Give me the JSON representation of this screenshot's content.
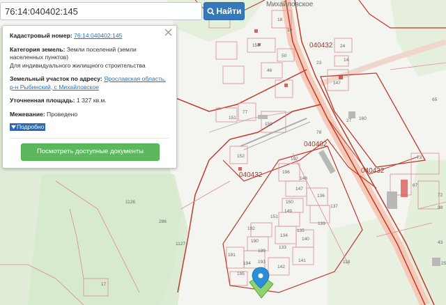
{
  "search": {
    "value": "76:14:040402:145",
    "button_label": "Найти"
  },
  "map": {
    "locality": "Михайловское",
    "quarters": [
      "040432",
      "040402",
      "040432",
      "040432"
    ],
    "parcels": [
      "19",
      "18",
      "150",
      "50",
      "46",
      "23",
      "24",
      "14",
      "147",
      "27",
      "77",
      "151",
      "159",
      "78",
      "160",
      "152",
      "197",
      "196",
      "147",
      "148",
      "149",
      "136",
      "150",
      "137",
      "192",
      "151",
      "135",
      "134",
      "133",
      "139",
      "190",
      "189",
      "140",
      "191",
      "194",
      "193",
      "142",
      "141",
      "195",
      "1126",
      "286",
      "1127",
      "118",
      "17",
      "65",
      "73",
      "67",
      "72",
      "43",
      "38",
      "25"
    ]
  },
  "popup": {
    "cadastral_label": "Кадастровый номер:",
    "cadastral_value": "76:14:040402:145",
    "category_label": "Категория земель:",
    "category_value": "Земли поселений (земли населенных пунктов)",
    "use_value": "Для индивидуального жилищного строительства",
    "address_label": "Земельный участок по адресу:",
    "address_value": "Ярославская область, р-н Рыбинский, с Михайловское",
    "area_label": "Уточненная площадь:",
    "area_value": "1 327 кв.м.",
    "survey_label": "Межевание:",
    "survey_value": "Проведено",
    "more_label": "Подробно",
    "docs_button": "Посмотреть доступные документы"
  },
  "colors": {
    "boundary": "#c0392b",
    "parcel_line": "#d98b8b",
    "forest": "#d9ead0",
    "selected_parcel": "#8fd26f",
    "marker": "#2a8fd6",
    "label": "#666666"
  }
}
